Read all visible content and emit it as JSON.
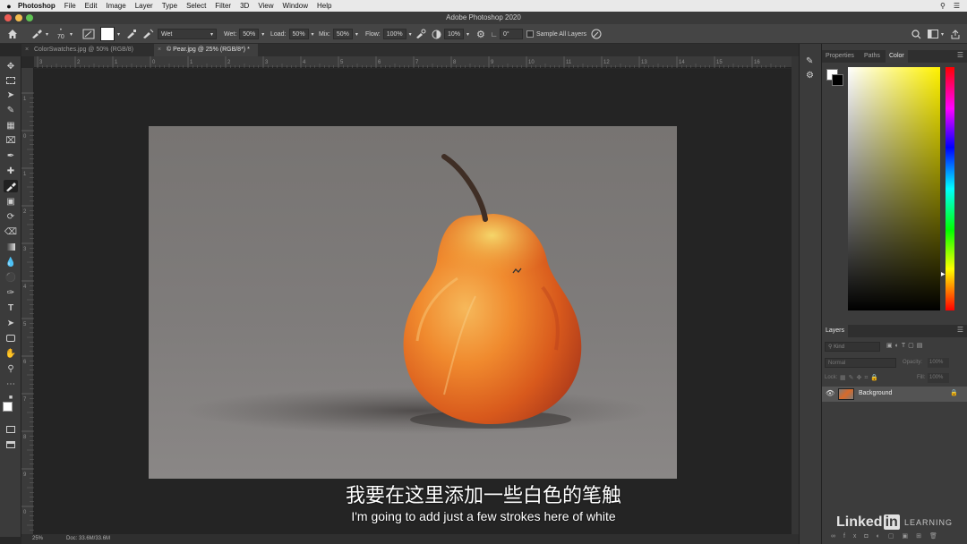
{
  "menubar": {
    "apple": "",
    "app": "Photoshop",
    "items": [
      "File",
      "Edit",
      "Image",
      "Layer",
      "Type",
      "Select",
      "Filter",
      "3D",
      "View",
      "Window",
      "Help"
    ]
  },
  "window": {
    "title": "Adobe Photoshop 2020"
  },
  "options": {
    "brush_size": "70",
    "preset": "Wet",
    "wet_label": "Wet:",
    "wet_value": "50%",
    "load_label": "Load:",
    "load_value": "50%",
    "mix_label": "Mix:",
    "mix_value": "50%",
    "flow_label": "Flow:",
    "flow_value": "100%",
    "smoothing_value": "10%",
    "angle_value": "0°",
    "sample_all_layers": "Sample All Layers"
  },
  "tabs": [
    {
      "label": "ColorSwatches.jpg @ 50% (RGB/8)"
    },
    {
      "label": "© Pear.jpg @ 25% (RGB/8*) *"
    }
  ],
  "ruler_top": [
    "3",
    "2",
    "1",
    "0",
    "1",
    "2",
    "3",
    "4",
    "5",
    "6",
    "7",
    "8",
    "9",
    "10",
    "11",
    "12",
    "13",
    "14",
    "15",
    "16"
  ],
  "ruler_left": [
    "1",
    "0",
    "1",
    "2",
    "3",
    "4",
    "5",
    "6",
    "7",
    "8",
    "9",
    "0"
  ],
  "panels": {
    "color_tabs": [
      "Properties",
      "Paths",
      "Color"
    ],
    "layers_tab": "Layers",
    "kind_placeholder": "Kind",
    "blend_mode": "Normal",
    "opacity_label": "Opacity:",
    "opacity_value": "100%",
    "lock_label": "Lock:",
    "fill_label": "Fill:",
    "fill_value": "100%",
    "layer_name": "Background"
  },
  "status": {
    "zoom": "25%",
    "doc": "Doc: 33.6M/33.6M"
  },
  "subtitles": {
    "cn": "我要在这里添加一些白色的笔触",
    "en": "I'm going to add just a few strokes here of white"
  },
  "brand": {
    "logo_text": "Linked",
    "logo_in": "in",
    "learning": "LEARNING"
  },
  "colors": {
    "accent": "#fff200",
    "foreground": "#ffffff",
    "background": "#000000"
  }
}
